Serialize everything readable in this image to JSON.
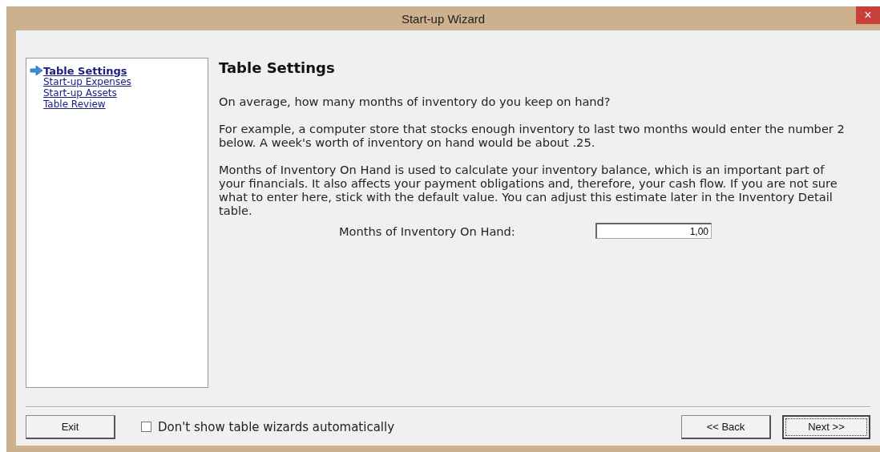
{
  "window": {
    "title": "Start-up Wizard",
    "close": "×"
  },
  "steps": [
    {
      "label": "Table Settings",
      "selected": true
    },
    {
      "label": "Start-up Expenses",
      "selected": false
    },
    {
      "label": "Start-up Assets",
      "selected": false
    },
    {
      "label": "Table Review",
      "selected": false
    }
  ],
  "page": {
    "heading": "Table Settings",
    "paragraphs": [
      "On average, how many months of inventory do you keep on hand?",
      "For example, a computer store that stocks enough inventory to last two months would enter the number 2 below. A week's worth of inventory on hand would be about .25.",
      "Months of Inventory On Hand is used to calculate your inventory balance, which is an important part of your financials. It also affects your payment obligations and, therefore, your cash flow. If you are not sure what to enter here, stick with the default value. You can adjust this estimate later in the Inventory Detail table."
    ]
  },
  "field": {
    "label": "Months of Inventory On Hand:",
    "value": "1,00"
  },
  "footer": {
    "exit": "Exit",
    "checkbox": {
      "label": "Don't show table wizards automatically",
      "checked": false
    },
    "back": "<< Back",
    "next": "Next >>"
  }
}
